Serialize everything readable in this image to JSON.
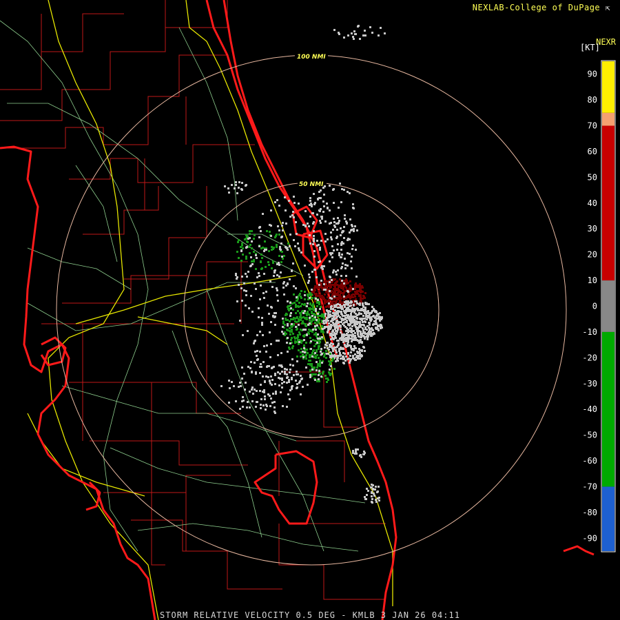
{
  "header": {
    "source": "NEXLAB-College of DuPage",
    "product_code": "NEXR",
    "units": "[KT]"
  },
  "footer": {
    "caption": "STORM RELATIVE VELOCITY 0.5 DEG - KMLB 3 JAN 26 04:11"
  },
  "range_rings": [
    {
      "label": "100 NMI",
      "nmi": 100
    },
    {
      "label": "50 NMI",
      "nmi": 50
    }
  ],
  "legend": {
    "ticks": [
      "90",
      "80",
      "70",
      "60",
      "50",
      "40",
      "30",
      "20",
      "10",
      "0",
      "-10",
      "-20",
      "-30",
      "-40",
      "-50",
      "-60",
      "-70",
      "-80",
      "-90"
    ],
    "bands": [
      {
        "from": 95,
        "to": 75,
        "color": "#ffee00"
      },
      {
        "from": 75,
        "to": 70,
        "color": "#f5a070"
      },
      {
        "from": 70,
        "to": 10,
        "color": "#c80000"
      },
      {
        "from": 10,
        "to": -10,
        "color": "#888888"
      },
      {
        "from": -10,
        "to": -70,
        "color": "#00aa00"
      },
      {
        "from": -70,
        "to": -95,
        "color": "#1e60d0"
      }
    ]
  },
  "colors": {
    "county_lines": "#c01818",
    "coastline": "#ff1a1a",
    "highways": "#e6e600",
    "roads": "#8fd08f",
    "range_ring": "#e8b8a0",
    "outbound_velocity": "#7a0000",
    "inbound_velocity": "#1a9a1a",
    "near_zero_velocity": "#c8c8c8"
  }
}
